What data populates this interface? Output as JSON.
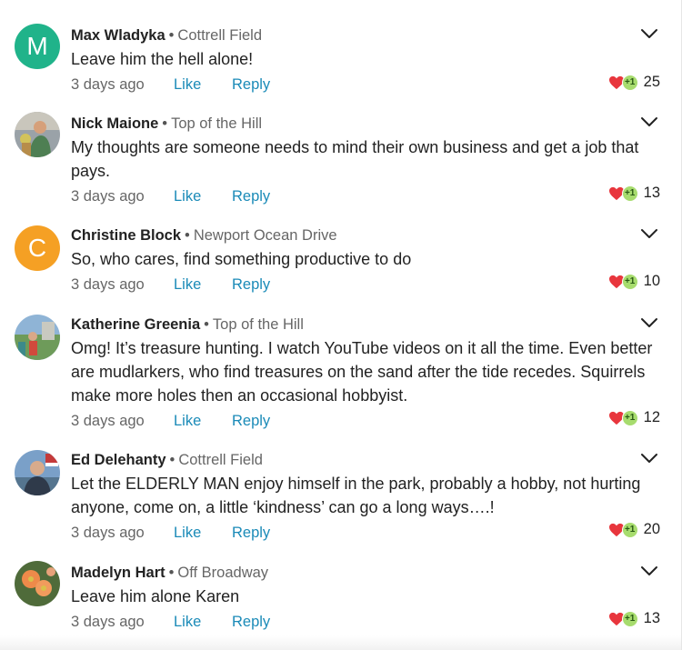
{
  "comments": [
    {
      "author": "Max Wladyka",
      "neighborhood": "Cottrell Field",
      "text": "Leave him the hell alone!",
      "time": "3 days ago",
      "like": "Like",
      "reply": "Reply",
      "count": "25",
      "avatar_letter": "M",
      "avatar_color": "#20b38a"
    },
    {
      "author": "Nick Maione",
      "neighborhood": "Top of the Hill",
      "text": "My thoughts are someone needs to mind their own business and get a job that pays.",
      "time": "3 days ago",
      "like": "Like",
      "reply": "Reply",
      "count": "13"
    },
    {
      "author": "Christine Block",
      "neighborhood": "Newport Ocean Drive",
      "text": "So, who cares, find something productive to do",
      "time": "3 days ago",
      "like": "Like",
      "reply": "Reply",
      "count": "10",
      "avatar_letter": "C",
      "avatar_color": "#f5a024"
    },
    {
      "author": "Katherine Greenia",
      "neighborhood": "Top of the Hill",
      "text": "Omg! It’s treasure hunting. I watch YouTube videos on it all the time. Even better are mudlarkers, who find treasures on the sand after the tide recedes. Squirrels make more holes then an occasional hobbyist.",
      "time": "3 days ago",
      "like": "Like",
      "reply": "Reply",
      "count": "12"
    },
    {
      "author": "Ed Delehanty",
      "neighborhood": "Cottrell Field",
      "text": "Let the ELDERLY MAN enjoy himself in the park, probably a hobby, not hurting anyone, come on, a little ‘kindness’ can go a long ways….!",
      "time": "3 days ago",
      "like": "Like",
      "reply": "Reply",
      "count": "20"
    },
    {
      "author": "Madelyn Hart",
      "neighborhood": "Off Broadway",
      "text": "Leave him alone Karen",
      "time": "3 days ago",
      "like": "Like",
      "reply": "Reply",
      "count": "13"
    }
  ],
  "separator": "•",
  "reaction_plus": "+1",
  "icons": {
    "expand": "chevron-down-icon",
    "reaction": "heart-icon"
  },
  "colors": {
    "link": "#1b8bb8",
    "heart": "#e8363d",
    "plus": "#a7dc6e"
  }
}
